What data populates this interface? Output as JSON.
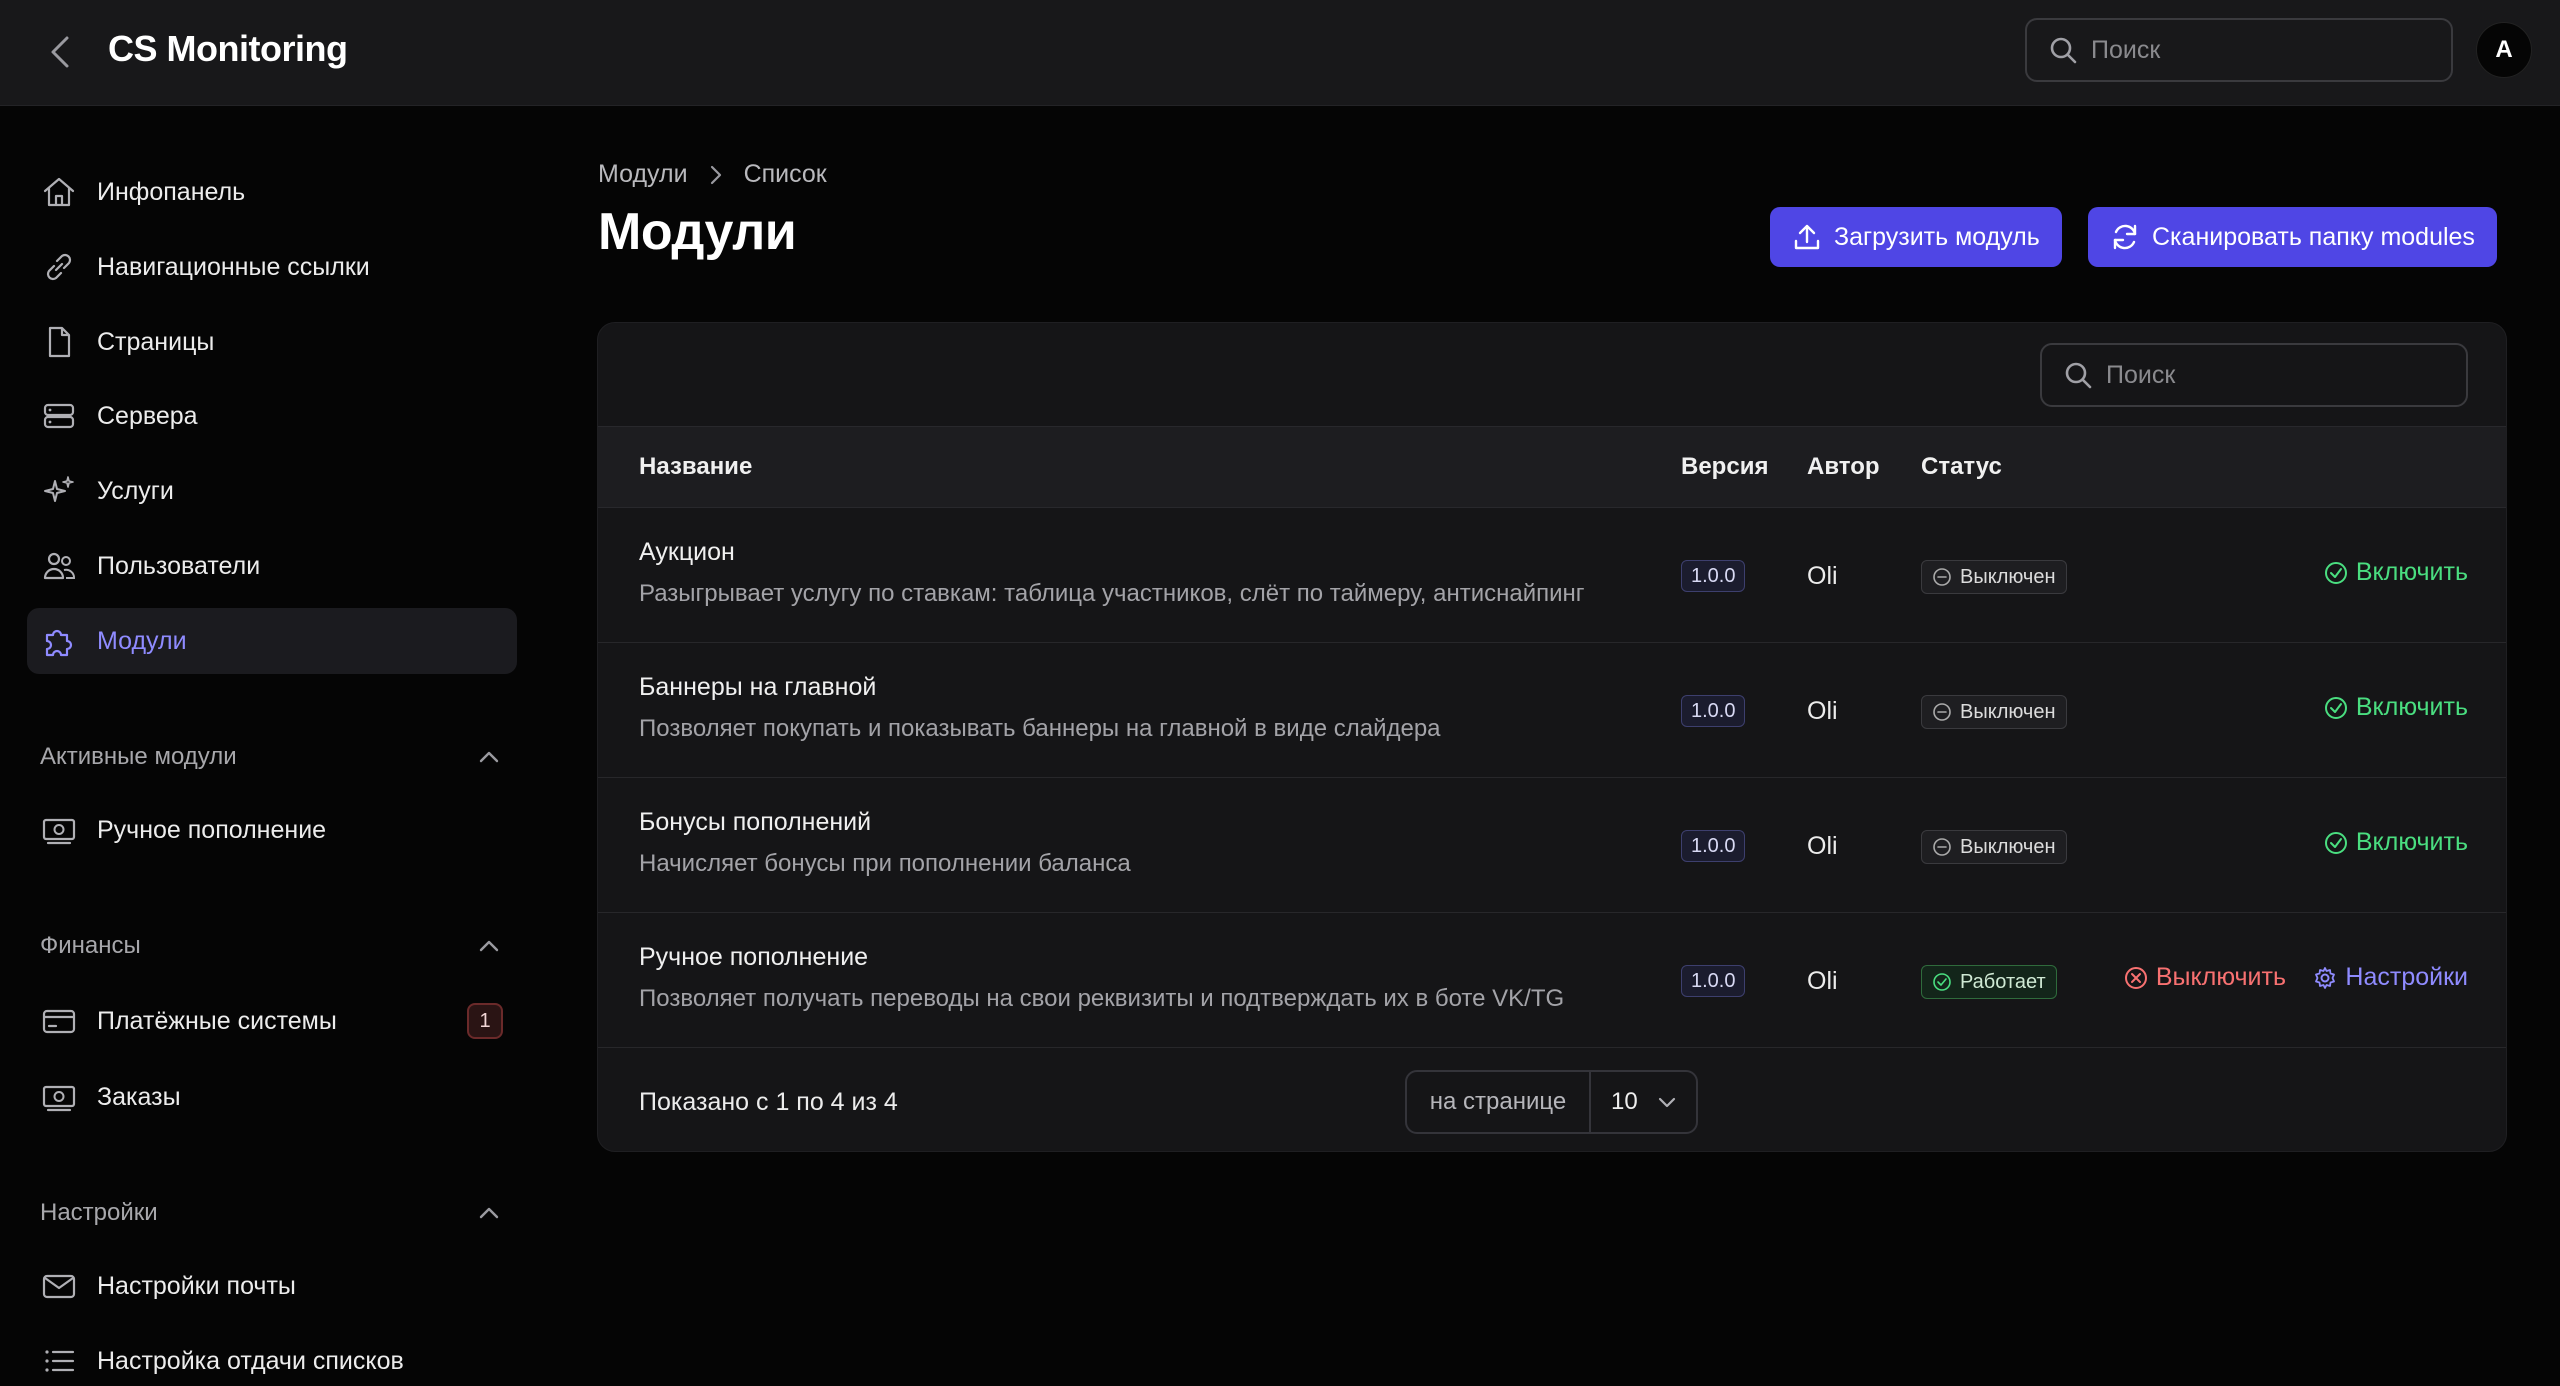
{
  "app": {
    "title": "CS Monitoring",
    "avatar_letter": "A"
  },
  "header": {
    "search_placeholder": "Поиск"
  },
  "sidebar": {
    "items": [
      {
        "label": "Инфопанель",
        "icon": "home-icon"
      },
      {
        "label": "Навигационные ссылки",
        "icon": "link-icon"
      },
      {
        "label": "Страницы",
        "icon": "page-icon"
      },
      {
        "label": "Сервера",
        "icon": "server-icon"
      },
      {
        "label": "Услуги",
        "icon": "sparkles-icon"
      },
      {
        "label": "Пользователи",
        "icon": "users-icon"
      },
      {
        "label": "Модули",
        "icon": "puzzle-icon",
        "active": true
      }
    ],
    "sections": [
      {
        "title": "Активные модули",
        "items": [
          {
            "label": "Ручное пополнение",
            "icon": "cash-icon"
          }
        ]
      },
      {
        "title": "Финансы",
        "items": [
          {
            "label": "Платёжные системы",
            "icon": "card-icon",
            "badge": "1"
          },
          {
            "label": "Заказы",
            "icon": "cash-icon"
          }
        ]
      },
      {
        "title": "Настройки",
        "items": [
          {
            "label": "Настройки почты",
            "icon": "mail-icon"
          },
          {
            "label": "Настройка отдачи списков",
            "icon": "list-icon"
          }
        ]
      }
    ]
  },
  "breadcrumb": {
    "root": "Модули",
    "current": "Список"
  },
  "page": {
    "title": "Модули",
    "upload_button": "Загрузить модуль",
    "scan_button": "Сканировать папку modules"
  },
  "table": {
    "search_placeholder": "Поиск",
    "columns": {
      "name": "Название",
      "version": "Версия",
      "author": "Автор",
      "status": "Статус"
    },
    "rows": [
      {
        "name": "Аукцион",
        "desc": "Разыгрывает услугу по ставкам: таблица участников, слёт по таймеру, антиснайпинг",
        "version": "1.0.0",
        "author": "Oli",
        "status": "Выключен",
        "action": "Включить"
      },
      {
        "name": "Баннеры на главной",
        "desc": "Позволяет покупать и показывать баннеры на главной в виде слайдера",
        "version": "1.0.0",
        "author": "Oli",
        "status": "Выключен",
        "action": "Включить"
      },
      {
        "name": "Бонусы пополнений",
        "desc": "Начисляет бонусы при пополнении баланса",
        "version": "1.0.0",
        "author": "Oli",
        "status": "Выключен",
        "action": "Включить"
      },
      {
        "name": "Ручное пополнение",
        "desc": "Позволяет получать переводы на свои реквизиты и подтверждать их в боте VK/TG",
        "version": "1.0.0",
        "author": "Oli",
        "status": "Работает",
        "action": "Выключить",
        "action2": "Настройки"
      }
    ],
    "footer": {
      "shown": "Показано с 1 по 4 из 4",
      "per_page_label": "на странице",
      "per_page_value": "10"
    }
  },
  "colors": {
    "accent": "#4f46e5",
    "active_text": "#8f8bff",
    "success": "#4ade80",
    "danger": "#f87171"
  }
}
